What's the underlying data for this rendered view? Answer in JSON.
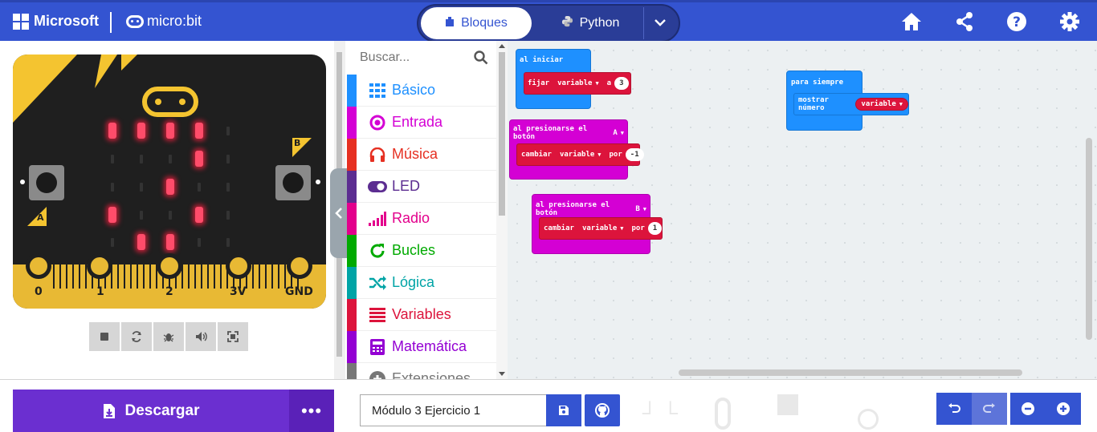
{
  "header": {
    "brand": "Microsoft",
    "product": "micro:bit",
    "tabs": [
      {
        "label": "Bloques",
        "icon": "puzzle-icon",
        "active": true
      },
      {
        "label": "Python",
        "icon": "python-icon",
        "active": false
      }
    ],
    "icons": [
      "home-icon",
      "share-icon",
      "help-icon",
      "settings-icon"
    ],
    "color": "#3454d1"
  },
  "simulator": {
    "button_a": "A",
    "button_b": "B",
    "pins": [
      "0",
      "1",
      "2",
      "3V",
      "GND"
    ],
    "leds": [
      [
        1,
        1,
        1,
        1,
        0
      ],
      [
        0,
        0,
        0,
        1,
        0
      ],
      [
        0,
        0,
        1,
        0,
        0
      ],
      [
        1,
        0,
        0,
        1,
        0
      ],
      [
        0,
        1,
        1,
        0,
        0
      ]
    ],
    "controls": [
      "stop-icon",
      "restart-icon",
      "debug-icon",
      "mute-icon",
      "fullscreen-icon"
    ]
  },
  "toolbox": {
    "search_placeholder": "Buscar...",
    "categories": [
      {
        "label": "Básico",
        "color": "#1e90ff",
        "icon": "grid-icon"
      },
      {
        "label": "Entrada",
        "color": "#d400d4",
        "icon": "input-icon"
      },
      {
        "label": "Música",
        "color": "#e63022",
        "icon": "headphones-icon"
      },
      {
        "label": "LED",
        "color": "#5c2d91",
        "icon": "toggle-icon"
      },
      {
        "label": "Radio",
        "color": "#e3008c",
        "icon": "signal-icon"
      },
      {
        "label": "Bucles",
        "color": "#00aa00",
        "icon": "loop-icon"
      },
      {
        "label": "Lógica",
        "color": "#00a4a6",
        "icon": "shuffle-icon"
      },
      {
        "label": "Variables",
        "color": "#dc143c",
        "icon": "list-icon"
      },
      {
        "label": "Matemática",
        "color": "#9400d3",
        "icon": "calculator-icon"
      },
      {
        "label": "Extensiones",
        "color": "#777777",
        "icon": "plus-icon"
      }
    ]
  },
  "workspace": {
    "on_start": {
      "label": "al iniciar",
      "set": "fijar",
      "var": "variable",
      "to": "a",
      "value": "3"
    },
    "button_a": {
      "label": "al presionarse el botón",
      "button": "A",
      "change": "cambiar",
      "var": "variable",
      "by": "por",
      "value": "-1"
    },
    "button_b": {
      "label": "al presionarse el botón",
      "button": "B",
      "change": "cambiar",
      "var": "variable",
      "by": "por",
      "value": "1"
    },
    "forever": {
      "label": "para siempre",
      "show": "mostrar número",
      "var": "variable"
    }
  },
  "footer": {
    "download_label": "Descargar",
    "more_label": "•••",
    "project_name": "Módulo 3 Ejercicio 1"
  }
}
